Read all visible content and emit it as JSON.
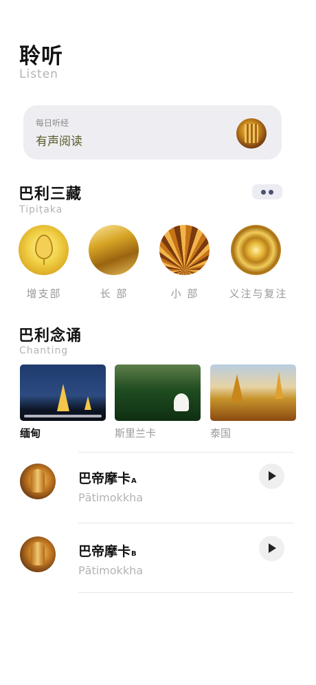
{
  "header": {
    "title": "聆听",
    "subtitle": "Listen"
  },
  "daily": {
    "label": "每日听经",
    "title": "有声阅读"
  },
  "tipitaka": {
    "title": "巴利三藏",
    "subtitle": "Tipiṭaka",
    "items": [
      {
        "label": "增支部"
      },
      {
        "label": "长 部"
      },
      {
        "label": "小 部"
      },
      {
        "label": "义注与复注"
      }
    ]
  },
  "chanting": {
    "title": "巴利念诵",
    "subtitle": "Chanting",
    "items": [
      {
        "label": "缅甸",
        "active": true
      },
      {
        "label": "斯里兰卡",
        "active": false
      },
      {
        "label": "泰国",
        "active": false
      }
    ]
  },
  "tracks": [
    {
      "title": "巴帝摩卡",
      "suffix": "A",
      "subtitle": "Pātimokkha"
    },
    {
      "title": "巴帝摩卡",
      "suffix": "B",
      "subtitle": "Pātimokkha"
    }
  ],
  "colors": {
    "accent": "#4a5270",
    "muted": "#b3b3b3",
    "card": "#eeeef2",
    "daily_title": "#5a5a2a"
  },
  "icons": {
    "more": "more-dots-icon",
    "play": "play-icon"
  }
}
